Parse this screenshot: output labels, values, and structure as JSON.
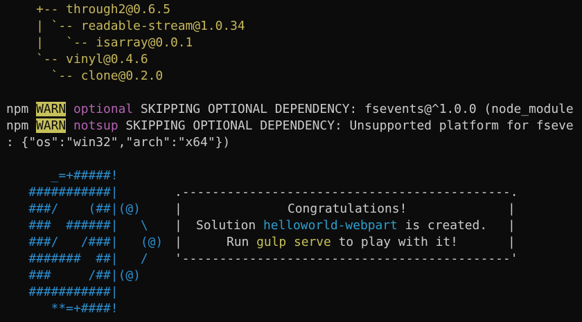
{
  "tree": [
    "    +-- through2@0.6.5",
    "    | `-- readable-stream@1.0.34",
    "    |   `-- isarray@0.0.1",
    "    `-- vinyl@0.4.6",
    "      `-- clone@0.2.0"
  ],
  "warnings": [
    {
      "prefix": "npm ",
      "level": "WARN",
      "tag": "optional",
      "message": " SKIPPING OPTIONAL DEPENDENCY: fsevents@^1.0.0 (node_module"
    },
    {
      "prefix": "npm ",
      "level": "WARN",
      "tag": "notsup",
      "message": " SKIPPING OPTIONAL DEPENDENCY: Unsupported platform for fseve"
    }
  ],
  "platform_line": ": {\"os\":\"win32\",\"arch\":\"x64\"})",
  "logo": [
    "      _=+#####!",
    "   ###########|",
    "   ###/    (##|(@)",
    "   ###  ######|   \\",
    "   ###/   /###|   (@)",
    "   #######  ##|   /",
    "   ###     /##|(@)",
    "   ###########|",
    "      **=+####!"
  ],
  "box": {
    "top": ".--------------------------------------------.",
    "bottom": "'--------------------------------------------'",
    "line1": "Congratulations!",
    "line2_pre": "Solution ",
    "line2_name": "helloworld-webpart",
    "line2_post": " is created.",
    "line3_pre": "Run ",
    "line3_cmd": "gulp serve",
    "line3_post": " to play with it!"
  },
  "colors": {
    "background": "#0c0c0c",
    "text": "#cccccc",
    "tree": "#c7b85b",
    "warn_bg": "#c7c15a",
    "tag": "#b464b4",
    "name": "#2f9fce",
    "command": "#c7c15a",
    "logo": "#2d8fd0"
  }
}
